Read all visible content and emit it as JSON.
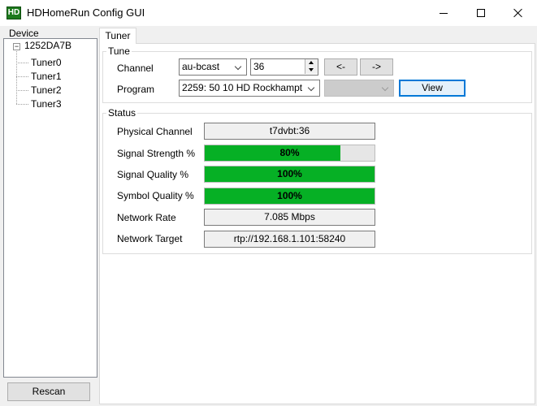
{
  "window": {
    "app_icon_text": "HD",
    "title": "HDHomeRun Config GUI"
  },
  "device_panel": {
    "label": "Device",
    "root": {
      "toggle": "−",
      "label": "1252DA7B"
    },
    "tuners": [
      "Tuner0",
      "Tuner1",
      "Tuner2",
      "Tuner3"
    ],
    "rescan_button": "Rescan"
  },
  "tabs": [
    {
      "label": "Tuner",
      "active": true
    }
  ],
  "tune": {
    "group_title": "Tune",
    "channel_label": "Channel",
    "channel_map": "au-bcast",
    "channel_number": "36",
    "prev_button": "<-",
    "next_button": "->",
    "program_label": "Program",
    "program_value": "2259: 50 10 HD Rockhampt",
    "secondary_value": "",
    "view_button": "View"
  },
  "status": {
    "group_title": "Status",
    "physical_channel_label": "Physical Channel",
    "physical_channel": "t7dvbt:36",
    "signal_strength_label": "Signal Strength %",
    "signal_strength_text": "80%",
    "signal_strength_fraction": 0.8,
    "signal_quality_label": "Signal Quality %",
    "signal_quality_text": "100%",
    "signal_quality_fraction": 1.0,
    "symbol_quality_label": "Symbol Quality %",
    "symbol_quality_text": "100%",
    "symbol_quality_fraction": 1.0,
    "network_rate_label": "Network Rate",
    "network_rate": "7.085 Mbps",
    "network_target_label": "Network Target",
    "network_target": "rtp://192.168.1.101:58240"
  },
  "colors": {
    "progress_fill": "#06b025",
    "view_button_border": "#0078d7"
  }
}
